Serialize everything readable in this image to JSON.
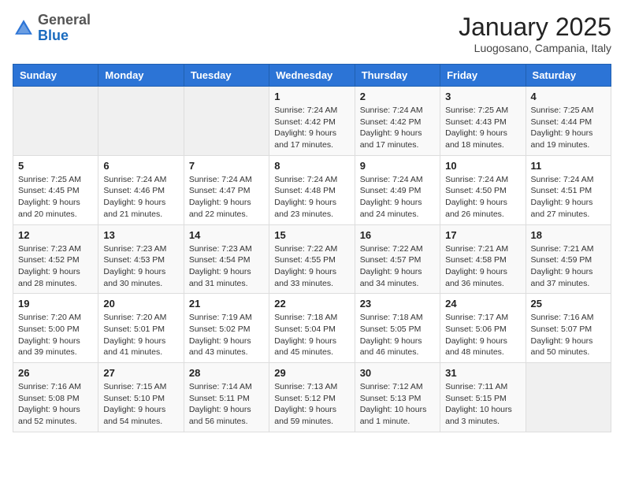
{
  "header": {
    "logo_general": "General",
    "logo_blue": "Blue",
    "month": "January 2025",
    "location": "Luogosano, Campania, Italy"
  },
  "days_of_week": [
    "Sunday",
    "Monday",
    "Tuesday",
    "Wednesday",
    "Thursday",
    "Friday",
    "Saturday"
  ],
  "weeks": [
    [
      {
        "day": "",
        "info": ""
      },
      {
        "day": "",
        "info": ""
      },
      {
        "day": "",
        "info": ""
      },
      {
        "day": "1",
        "info": "Sunrise: 7:24 AM\nSunset: 4:42 PM\nDaylight: 9 hours and 17 minutes."
      },
      {
        "day": "2",
        "info": "Sunrise: 7:24 AM\nSunset: 4:42 PM\nDaylight: 9 hours and 17 minutes."
      },
      {
        "day": "3",
        "info": "Sunrise: 7:25 AM\nSunset: 4:43 PM\nDaylight: 9 hours and 18 minutes."
      },
      {
        "day": "4",
        "info": "Sunrise: 7:25 AM\nSunset: 4:44 PM\nDaylight: 9 hours and 19 minutes."
      }
    ],
    [
      {
        "day": "5",
        "info": "Sunrise: 7:25 AM\nSunset: 4:45 PM\nDaylight: 9 hours and 20 minutes."
      },
      {
        "day": "6",
        "info": "Sunrise: 7:24 AM\nSunset: 4:46 PM\nDaylight: 9 hours and 21 minutes."
      },
      {
        "day": "7",
        "info": "Sunrise: 7:24 AM\nSunset: 4:47 PM\nDaylight: 9 hours and 22 minutes."
      },
      {
        "day": "8",
        "info": "Sunrise: 7:24 AM\nSunset: 4:48 PM\nDaylight: 9 hours and 23 minutes."
      },
      {
        "day": "9",
        "info": "Sunrise: 7:24 AM\nSunset: 4:49 PM\nDaylight: 9 hours and 24 minutes."
      },
      {
        "day": "10",
        "info": "Sunrise: 7:24 AM\nSunset: 4:50 PM\nDaylight: 9 hours and 26 minutes."
      },
      {
        "day": "11",
        "info": "Sunrise: 7:24 AM\nSunset: 4:51 PM\nDaylight: 9 hours and 27 minutes."
      }
    ],
    [
      {
        "day": "12",
        "info": "Sunrise: 7:23 AM\nSunset: 4:52 PM\nDaylight: 9 hours and 28 minutes."
      },
      {
        "day": "13",
        "info": "Sunrise: 7:23 AM\nSunset: 4:53 PM\nDaylight: 9 hours and 30 minutes."
      },
      {
        "day": "14",
        "info": "Sunrise: 7:23 AM\nSunset: 4:54 PM\nDaylight: 9 hours and 31 minutes."
      },
      {
        "day": "15",
        "info": "Sunrise: 7:22 AM\nSunset: 4:55 PM\nDaylight: 9 hours and 33 minutes."
      },
      {
        "day": "16",
        "info": "Sunrise: 7:22 AM\nSunset: 4:57 PM\nDaylight: 9 hours and 34 minutes."
      },
      {
        "day": "17",
        "info": "Sunrise: 7:21 AM\nSunset: 4:58 PM\nDaylight: 9 hours and 36 minutes."
      },
      {
        "day": "18",
        "info": "Sunrise: 7:21 AM\nSunset: 4:59 PM\nDaylight: 9 hours and 37 minutes."
      }
    ],
    [
      {
        "day": "19",
        "info": "Sunrise: 7:20 AM\nSunset: 5:00 PM\nDaylight: 9 hours and 39 minutes."
      },
      {
        "day": "20",
        "info": "Sunrise: 7:20 AM\nSunset: 5:01 PM\nDaylight: 9 hours and 41 minutes."
      },
      {
        "day": "21",
        "info": "Sunrise: 7:19 AM\nSunset: 5:02 PM\nDaylight: 9 hours and 43 minutes."
      },
      {
        "day": "22",
        "info": "Sunrise: 7:18 AM\nSunset: 5:04 PM\nDaylight: 9 hours and 45 minutes."
      },
      {
        "day": "23",
        "info": "Sunrise: 7:18 AM\nSunset: 5:05 PM\nDaylight: 9 hours and 46 minutes."
      },
      {
        "day": "24",
        "info": "Sunrise: 7:17 AM\nSunset: 5:06 PM\nDaylight: 9 hours and 48 minutes."
      },
      {
        "day": "25",
        "info": "Sunrise: 7:16 AM\nSunset: 5:07 PM\nDaylight: 9 hours and 50 minutes."
      }
    ],
    [
      {
        "day": "26",
        "info": "Sunrise: 7:16 AM\nSunset: 5:08 PM\nDaylight: 9 hours and 52 minutes."
      },
      {
        "day": "27",
        "info": "Sunrise: 7:15 AM\nSunset: 5:10 PM\nDaylight: 9 hours and 54 minutes."
      },
      {
        "day": "28",
        "info": "Sunrise: 7:14 AM\nSunset: 5:11 PM\nDaylight: 9 hours and 56 minutes."
      },
      {
        "day": "29",
        "info": "Sunrise: 7:13 AM\nSunset: 5:12 PM\nDaylight: 9 hours and 59 minutes."
      },
      {
        "day": "30",
        "info": "Sunrise: 7:12 AM\nSunset: 5:13 PM\nDaylight: 10 hours and 1 minute."
      },
      {
        "day": "31",
        "info": "Sunrise: 7:11 AM\nSunset: 5:15 PM\nDaylight: 10 hours and 3 minutes."
      },
      {
        "day": "",
        "info": ""
      }
    ]
  ]
}
